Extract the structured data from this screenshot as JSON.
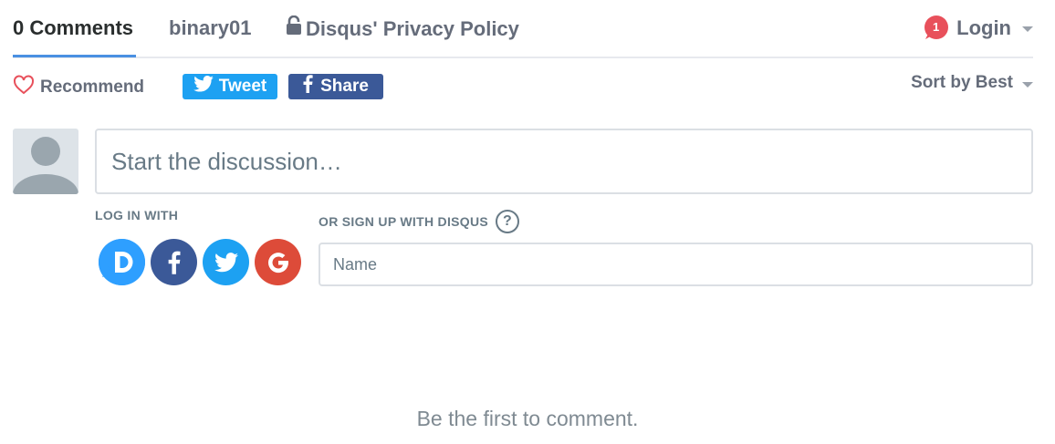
{
  "nav": {
    "comments_tab": "0 Comments",
    "forum_tab": "binary01",
    "privacy_tab": "Disqus' Privacy Policy",
    "notification_count": "1",
    "login_label": "Login"
  },
  "actions": {
    "recommend_label": "Recommend",
    "tweet_label": "Tweet",
    "share_label": "Share",
    "sort_label": "Sort by Best"
  },
  "composer": {
    "placeholder": "Start the discussion…"
  },
  "auth": {
    "login_with_label": "LOG IN WITH",
    "signup_label": "OR SIGN UP WITH DISQUS",
    "help_symbol": "?",
    "name_placeholder": "Name",
    "providers": [
      "disqus-icon",
      "facebook-icon",
      "twitter-icon",
      "google-icon"
    ]
  },
  "empty_state": "Be the first to comment.",
  "colors": {
    "accent": "#4a90e2",
    "twitter": "#1da1f2",
    "facebook": "#3b5998",
    "google": "#dd4b39",
    "disqus": "#2e9fff",
    "notification": "#e8505b"
  }
}
